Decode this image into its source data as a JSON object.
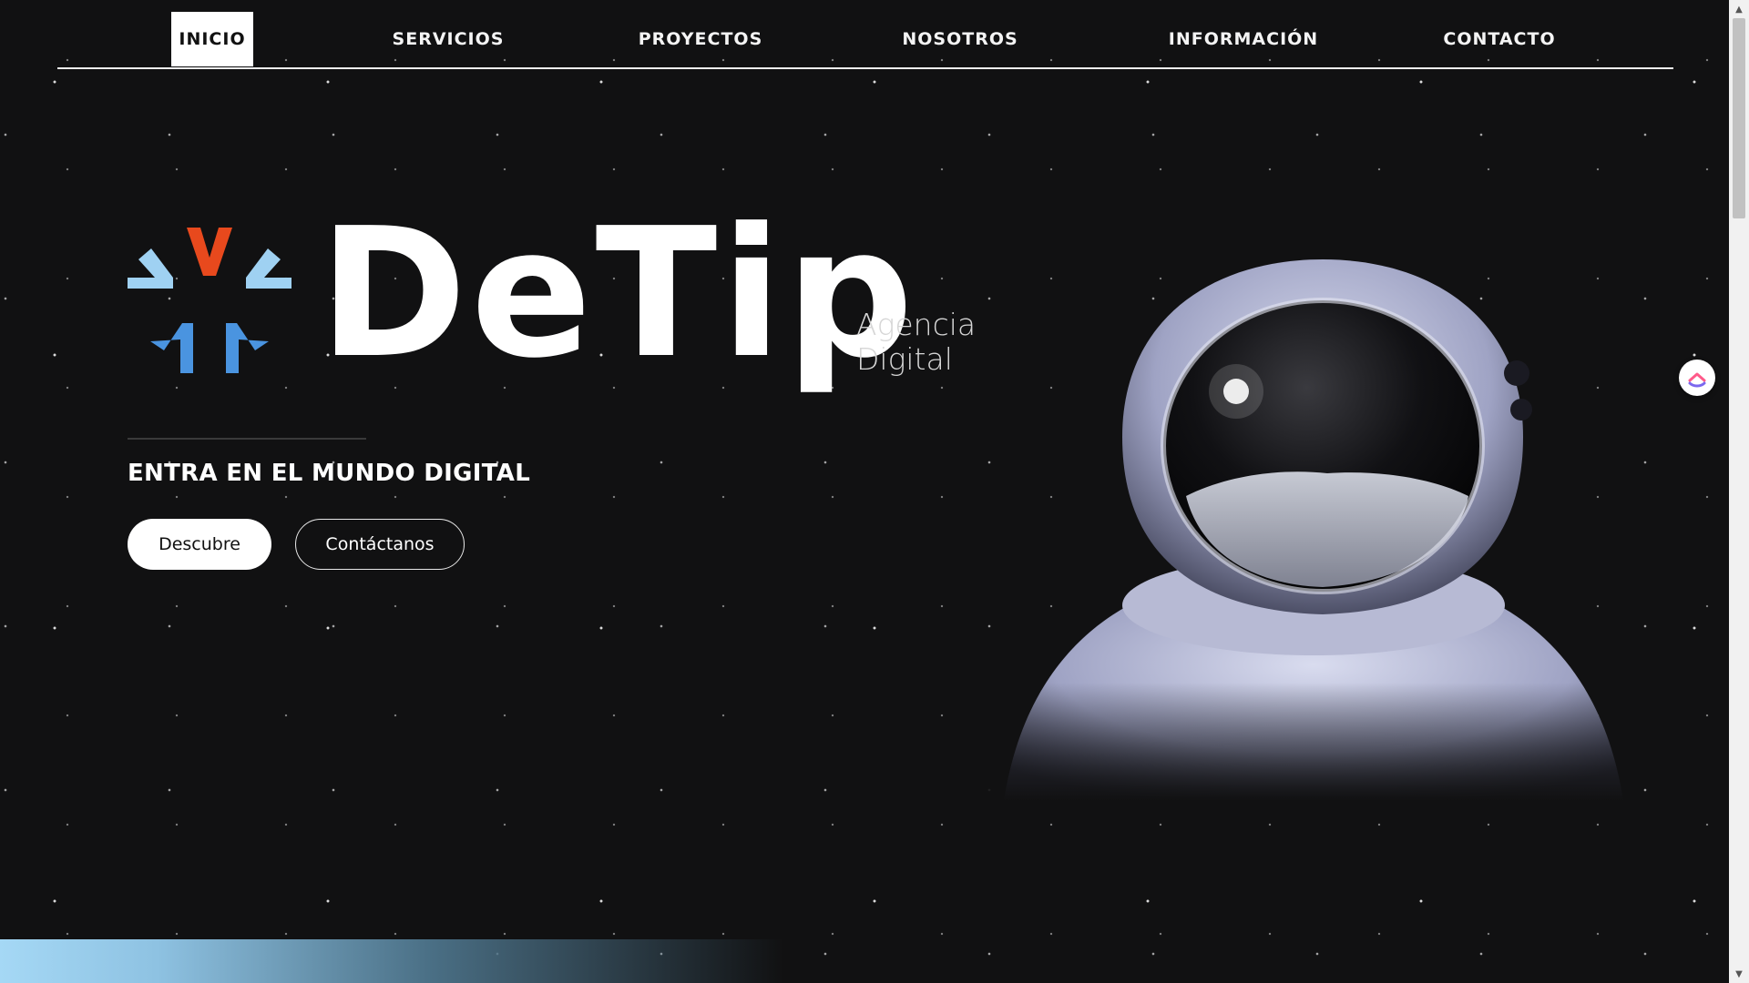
{
  "nav": {
    "items": [
      {
        "label": "INICIO",
        "active": true
      },
      {
        "label": "SERVICIOS",
        "active": false
      },
      {
        "label": "PROYECTOS",
        "active": false
      },
      {
        "label": "NOSOTROS",
        "active": false
      },
      {
        "label": "INFORMACIÓN",
        "active": false
      },
      {
        "label": "CONTACTO",
        "active": false
      }
    ]
  },
  "brand": {
    "name": "DeTip",
    "tagline_line1": "Agencia",
    "tagline_line2": "Digital",
    "mark_colors": {
      "accent": "#e8491d",
      "blue_light": "#9fd1f2",
      "blue": "#4a94e0"
    }
  },
  "hero": {
    "headline": "ENTRA EN EL MUNDO DIGITAL",
    "primary_button": "Descubre",
    "secondary_button": "Contáctanos"
  },
  "widget": {
    "icon": "clickup-icon"
  },
  "colors": {
    "background": "#111112",
    "text": "#ffffff"
  }
}
